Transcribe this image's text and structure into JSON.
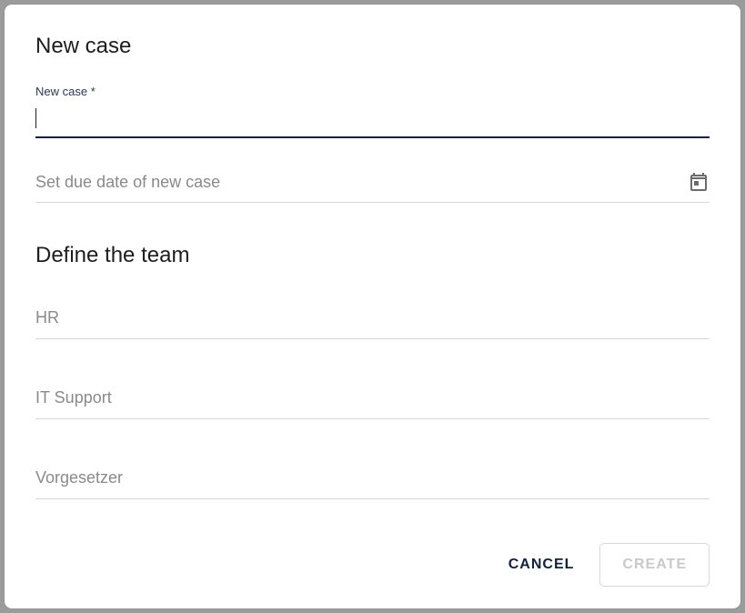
{
  "dialog": {
    "title": "New case",
    "caseField": {
      "label": "New case *",
      "value": ""
    },
    "dueDate": {
      "placeholder": "Set due date of new case"
    },
    "teamSection": {
      "title": "Define the team",
      "fields": [
        {
          "placeholder": "HR"
        },
        {
          "placeholder": "IT Support"
        },
        {
          "placeholder": "Vorgesetzer"
        }
      ]
    },
    "actions": {
      "cancel": "CANCEL",
      "create": "CREATE"
    }
  }
}
